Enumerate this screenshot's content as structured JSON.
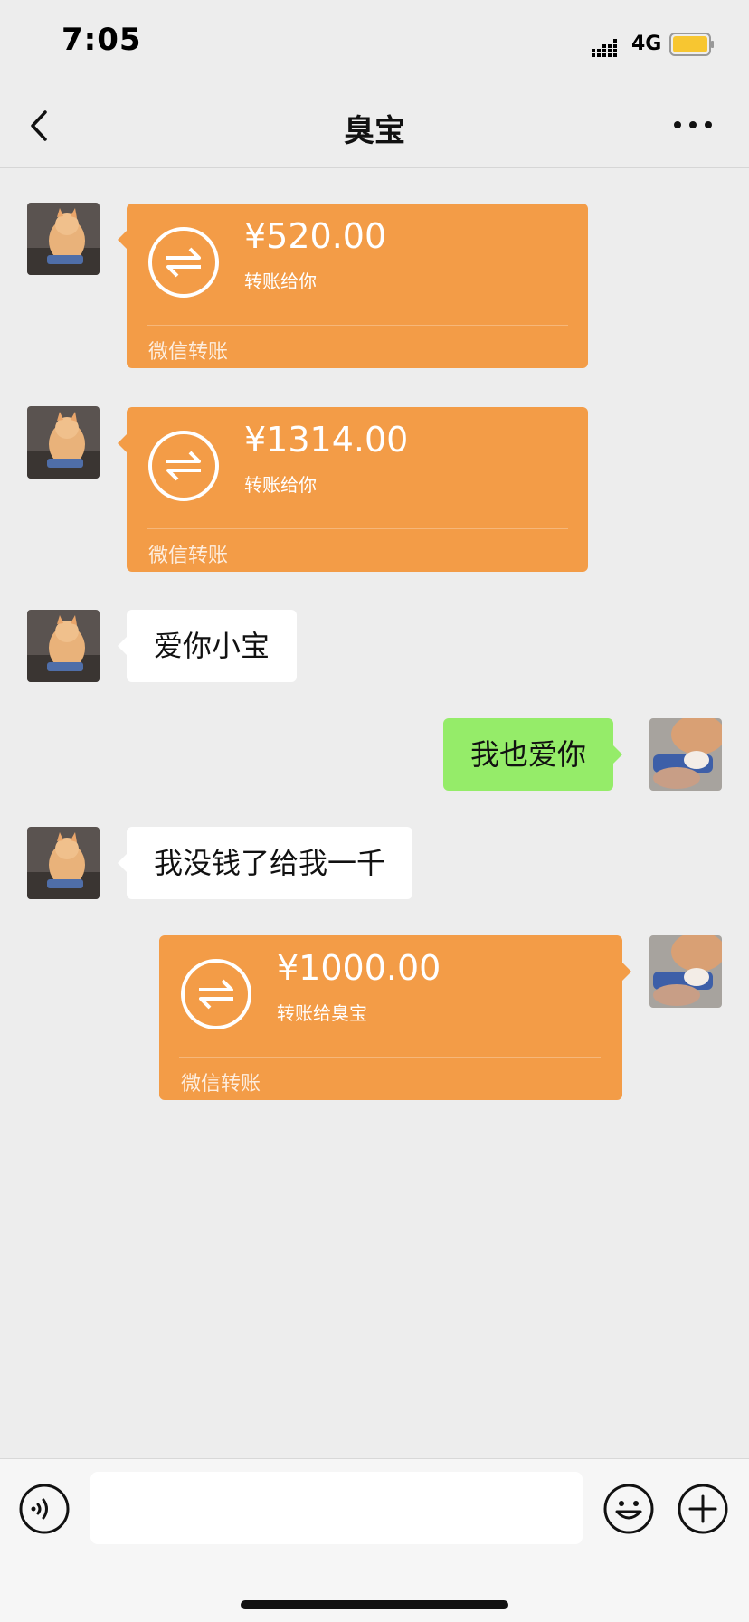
{
  "status": {
    "time": "7:05",
    "network": "4G",
    "icons": [
      "signal-icon",
      "battery-icon"
    ]
  },
  "header": {
    "title": "臭宝",
    "back_icon": "chevron-left-icon",
    "more_icon": "more-icon"
  },
  "colors": {
    "transfer": "#f39c47",
    "sent_bubble": "#95ec69",
    "received_bubble": "#ffffff",
    "background": "#ededed"
  },
  "messages": [
    {
      "type": "transfer",
      "side": "left",
      "amount": "¥520.00",
      "note": "转账给你",
      "label": "微信转账"
    },
    {
      "type": "transfer",
      "side": "left",
      "amount": "¥1314.00",
      "note": "转账给你",
      "label": "微信转账"
    },
    {
      "type": "text",
      "side": "left",
      "text": "爱你小宝"
    },
    {
      "type": "text",
      "side": "right",
      "text": "我也爱你"
    },
    {
      "type": "text",
      "side": "left",
      "text": "我没钱了给我一千"
    },
    {
      "type": "transfer",
      "side": "right",
      "amount": "¥1000.00",
      "note": "转账给臭宝",
      "label": "微信转账"
    }
  ],
  "input_bar": {
    "value": "",
    "placeholder": "",
    "icons": [
      "voice-icon",
      "emoji-icon",
      "plus-icon"
    ]
  }
}
